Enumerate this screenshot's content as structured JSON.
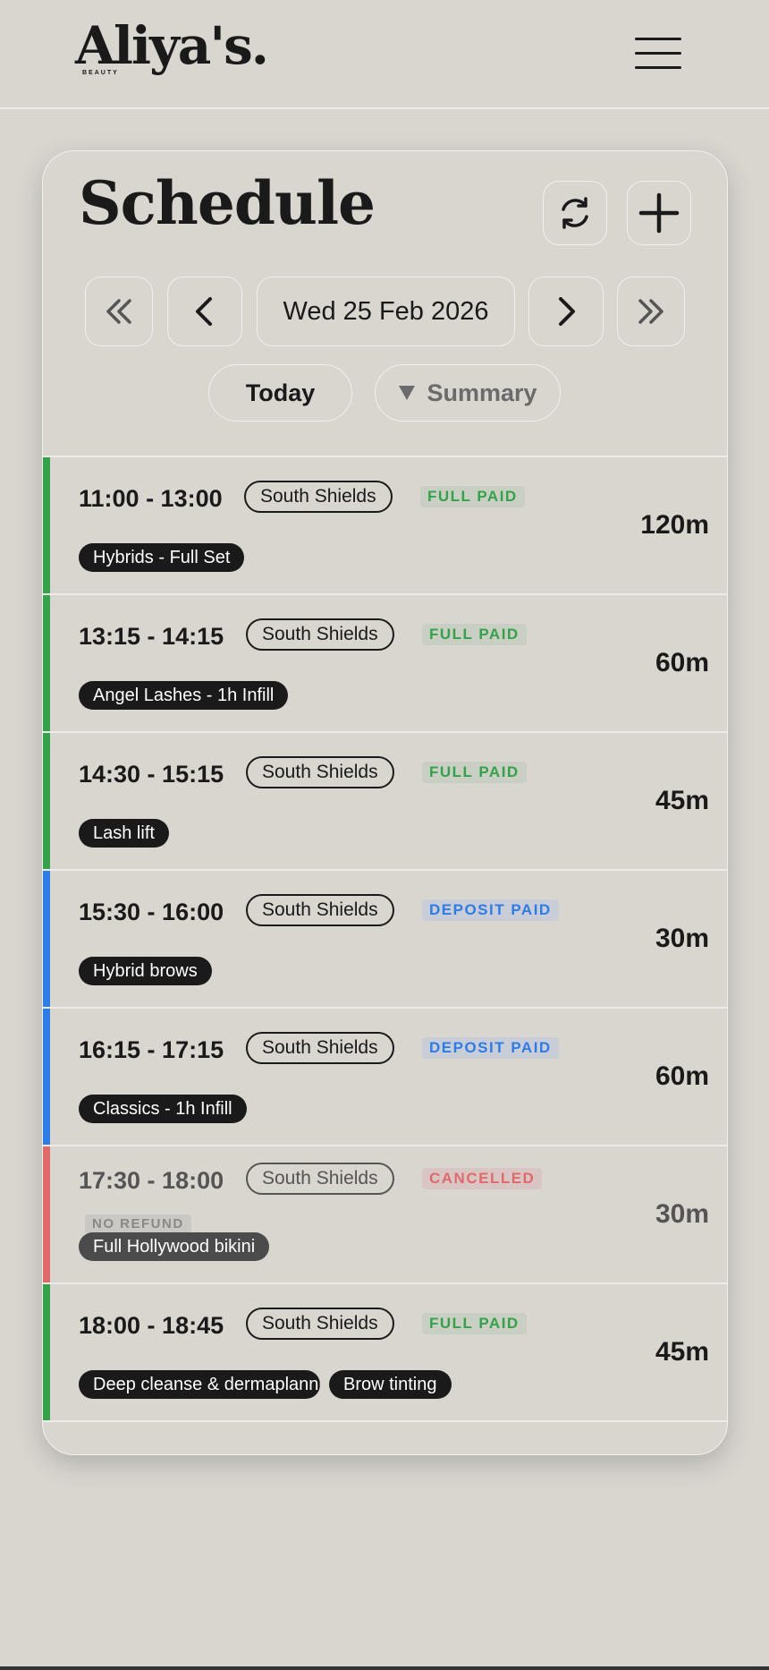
{
  "header": {
    "logo_text": "Aliya's.",
    "logo_subtext": "BEAUTY",
    "menu_icon": "hamburger-menu-icon"
  },
  "schedule": {
    "title": "Schedule",
    "refresh_icon": "refresh-icon",
    "add_icon": "plus-icon",
    "date": "Wed 25 Feb 2026",
    "today_label": "Today",
    "summary_label": "Summary",
    "summary_icon": "triangle-down-icon"
  },
  "colors": {
    "full_paid": "#35a14b",
    "deposit_paid": "#2e7ce6",
    "cancelled": "#e06a6a",
    "background": "#d9d6d0"
  },
  "appointments": [
    {
      "time": "11:00 - 13:00",
      "location": "South Shields",
      "status": "FULL PAID",
      "status_type": "full",
      "services": [
        "Hybrids - Full Set"
      ],
      "duration": "120m"
    },
    {
      "time": "13:15 - 14:15",
      "location": "South Shields",
      "status": "FULL PAID",
      "status_type": "full",
      "services": [
        "Angel Lashes - 1h Infill"
      ],
      "duration": "60m"
    },
    {
      "time": "14:30 - 15:15",
      "location": "South Shields",
      "status": "FULL PAID",
      "status_type": "full",
      "services": [
        "Lash lift"
      ],
      "duration": "45m"
    },
    {
      "time": "15:30 - 16:00",
      "location": "South Shields",
      "status": "DEPOSIT PAID",
      "status_type": "deposit",
      "services": [
        "Hybrid brows"
      ],
      "duration": "30m"
    },
    {
      "time": "16:15 - 17:15",
      "location": "South Shields",
      "status": "DEPOSIT PAID",
      "status_type": "deposit",
      "services": [
        "Classics - 1h Infill"
      ],
      "duration": "60m"
    },
    {
      "time": "17:30 - 18:00",
      "location": "South Shields",
      "status": "CANCELLED",
      "status_type": "cancelled",
      "note": "NO REFUND",
      "services": [
        "Full Hollywood bikini"
      ],
      "duration": "30m"
    },
    {
      "time": "18:00 - 18:45",
      "location": "South Shields",
      "status": "FULL PAID",
      "status_type": "full",
      "services": [
        "Deep cleanse & dermaplanning",
        "Brow tinting"
      ],
      "duration": "45m"
    }
  ]
}
